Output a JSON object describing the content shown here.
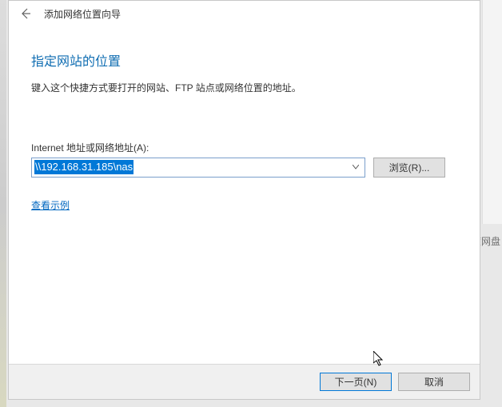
{
  "titlebar": {
    "title": "添加网络位置向导"
  },
  "content": {
    "heading": "指定网站的位置",
    "description": "键入这个快捷方式要打开的网站、FTP 站点或网络位置的地址。",
    "label": "Internet 地址或网络地址(A):",
    "address_value": "\\\\192.168.31.185\\nas",
    "browse_label": "浏览(R)...",
    "example_link": "查看示例"
  },
  "footer": {
    "next_label": "下一页(N)",
    "cancel_label": "取消"
  },
  "side": {
    "text": "度网盘"
  }
}
